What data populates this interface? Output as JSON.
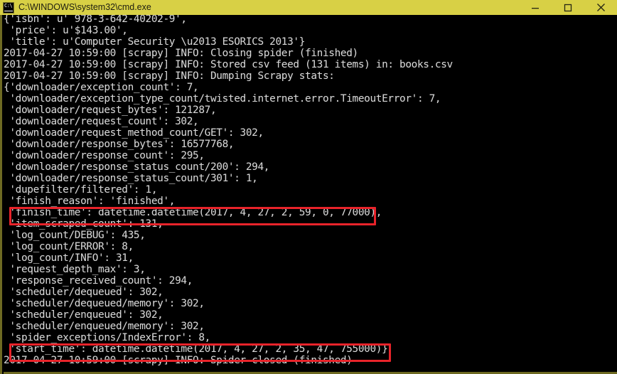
{
  "window": {
    "title": "C:\\WINDOWS\\system32\\cmd.exe",
    "icon": "cmd-console-icon",
    "titlebar_color": "#d8d045",
    "background_color": "#000000",
    "text_color": "#d6d6d6",
    "controls": {
      "minimize": "minimize",
      "maximize": "maximize",
      "close": "close"
    }
  },
  "annotations": {
    "highlight_color": "#e8232a",
    "boxes": [
      {
        "label": "finish-time-highlight",
        "target_line": 15
      },
      {
        "label": "start-time-highlight",
        "target_line": 24
      }
    ]
  },
  "console": {
    "lines": [
      "{'isbn': u' 978-3-642-40202-9',",
      " 'price': u'$143.00',",
      " 'title': u'Computer Security \\u2013 ESORICS 2013'}",
      "2017-04-27 10:59:00 [scrapy] INFO: Closing spider (finished)",
      "2017-04-27 10:59:00 [scrapy] INFO: Stored csv feed (131 items) in: books.csv",
      "2017-04-27 10:59:00 [scrapy] INFO: Dumping Scrapy stats:",
      "{'downloader/exception_count': 7,",
      " 'downloader/exception_type_count/twisted.internet.error.TimeoutError': 7,",
      " 'downloader/request_bytes': 121287,",
      " 'downloader/request_count': 302,",
      " 'downloader/request_method_count/GET': 302,",
      " 'downloader/response_bytes': 16577768,",
      " 'downloader/response_count': 295,",
      " 'downloader/response_status_count/200': 294,",
      " 'downloader/response_status_count/301': 1,",
      " 'dupefilter/filtered': 1,",
      " 'finish_reason': 'finished',",
      " 'finish_time': datetime.datetime(2017, 4, 27, 2, 59, 0, 77000),",
      " 'item_scraped_count': 131,",
      " 'log_count/DEBUG': 435,",
      " 'log_count/ERROR': 8,",
      " 'log_count/INFO': 31,",
      " 'request_depth_max': 3,",
      " 'response_received_count': 294,",
      " 'scheduler/dequeued': 302,",
      " 'scheduler/dequeued/memory': 302,",
      " 'scheduler/enqueued': 302,",
      " 'scheduler/enqueued/memory': 302,",
      " 'spider_exceptions/IndexError': 8,",
      " 'start_time': datetime.datetime(2017, 4, 27, 2, 35, 47, 755000)}",
      "2017-04-27 10:59:00 [scrapy] INFO: Spider closed (finished)"
    ]
  }
}
